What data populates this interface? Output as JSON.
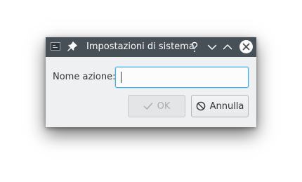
{
  "window": {
    "title": "Impostazioni di sistema"
  },
  "titlebar_icons": [
    "app-icon",
    "pin-icon",
    "help-icon",
    "minimize-icon",
    "maximize-icon",
    "close-icon"
  ],
  "form": {
    "label": "Nome azione:",
    "input_value": "",
    "input_placeholder": ""
  },
  "buttons": {
    "ok_label": "OK",
    "cancel_label": "Annulla"
  },
  "colors": {
    "titlebar": "#475057",
    "focus": "#3daee9",
    "dialog_bg": "#eff0f1"
  }
}
